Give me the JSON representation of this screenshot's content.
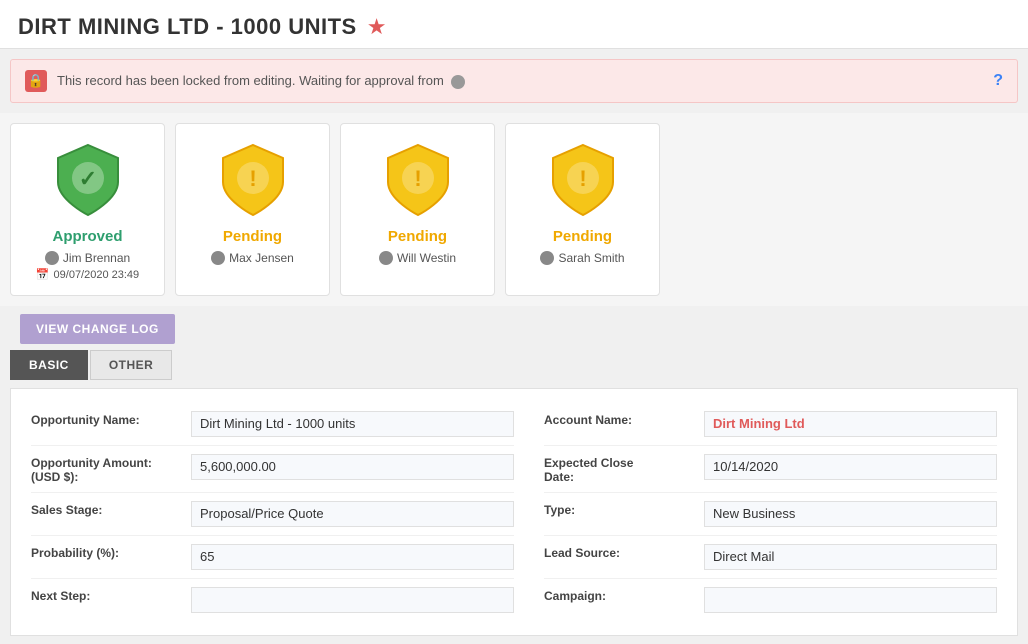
{
  "header": {
    "title": "DIRT MINING LTD - 1000 UNITS",
    "star": "★"
  },
  "lockBanner": {
    "text": "This record has been locked from editing. Waiting for approval from",
    "helpIcon": "?"
  },
  "approvalCards": [
    {
      "status": "Approved",
      "statusClass": "approved",
      "person": "Jim Brennan",
      "date": "09/07/2020 23:49",
      "showDate": true
    },
    {
      "status": "Pending",
      "statusClass": "pending",
      "person": "Max Jensen",
      "date": null,
      "showDate": false
    },
    {
      "status": "Pending",
      "statusClass": "pending",
      "person": "Will Westin",
      "date": null,
      "showDate": false
    },
    {
      "status": "Pending",
      "statusClass": "pending",
      "person": "Sarah Smith",
      "date": null,
      "showDate": false
    }
  ],
  "buttons": {
    "viewChangeLog": "VIEW CHANGE LOG"
  },
  "tabs": [
    {
      "label": "BASIC",
      "active": true
    },
    {
      "label": "OTHER",
      "active": false
    }
  ],
  "form": {
    "leftFields": [
      {
        "label": "Opportunity Name:",
        "value": "Dirt Mining Ltd - 1000 units",
        "isLink": false
      },
      {
        "label": "Opportunity Amount:\n(USD $):",
        "value": "5,600,000.00",
        "isLink": false
      },
      {
        "label": "Sales Stage:",
        "value": "Proposal/Price Quote",
        "isLink": false
      },
      {
        "label": "Probability (%):",
        "value": "65",
        "isLink": false
      },
      {
        "label": "Next Step:",
        "value": "",
        "isLink": false
      }
    ],
    "rightFields": [
      {
        "label": "Account Name:",
        "value": "Dirt Mining Ltd",
        "isLink": true
      },
      {
        "label": "Expected Close\nDate:",
        "value": "10/14/2020",
        "isLink": false
      },
      {
        "label": "Type:",
        "value": "New Business",
        "isLink": false
      },
      {
        "label": "Lead Source:",
        "value": "Direct Mail",
        "isLink": false
      },
      {
        "label": "Campaign:",
        "value": "",
        "isLink": false
      }
    ]
  }
}
